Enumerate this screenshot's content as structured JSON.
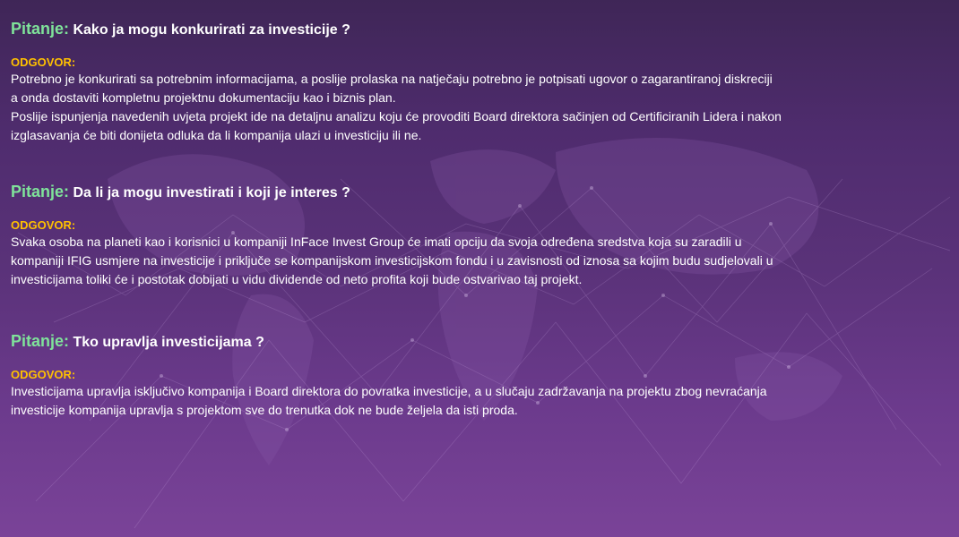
{
  "colors": {
    "question_prefix": "#7fe39a",
    "answer_label": "#ffc000",
    "text": "#ffffff",
    "background_top": "#3f2657",
    "background_bottom": "#7a4398"
  },
  "faq": [
    {
      "prefix": "Pitanje:",
      "question": "Kako ja mogu konkurirati za investicije ?",
      "answer_label": "ODGOVOR:",
      "answer_lines": [
        "Potrebno je konkurirati sa potrebnim informacijama, a poslije prolaska na natječaju potrebno je potpisati ugovor o zagarantiranoj diskreciji",
        "a onda dostaviti kompletnu projektnu dokumentaciju kao i biznis plan.",
        "Poslije ispunjenja navedenih uvjeta projekt ide na detaljnu analizu koju će provoditi Board direktora sačinjen od Certificiranih Lidera i nakon",
        "izglasavanja će biti donijeta odluka da li kompanija ulazi u investiciju ili ne."
      ]
    },
    {
      "prefix": "Pitanje:",
      "question": "Da li ja mogu investirati i koji je interes ?",
      "answer_label": "ODGOVOR:",
      "answer_lines": [
        "Svaka osoba na planeti kao i korisnici u kompaniji InFace Invest Group će imati opciju da svoja određena sredstva koja su zaradili u",
        "kompaniji IFIG usmjere na investicije i priključe se kompanijskom investicijskom fondu i u zavisnosti od iznosa sa kojim budu sudjelovali u",
        "investicijama toliki će i postotak dobijati u vidu dividende od neto profita koji bude ostvarivao taj projekt."
      ]
    },
    {
      "prefix": "Pitanje:",
      "question": "Tko upravlja investicijama ?",
      "answer_label": "ODGOVOR:",
      "answer_lines": [
        "Investicijama upravlja isključivo kompanija i Board direktora do povratka investicije, a u slučaju zadržavanja na projektu zbog nevraćanja",
        "investicije kompanija upravlja s projektom sve do trenutka dok ne bude željela da isti proda."
      ]
    }
  ]
}
